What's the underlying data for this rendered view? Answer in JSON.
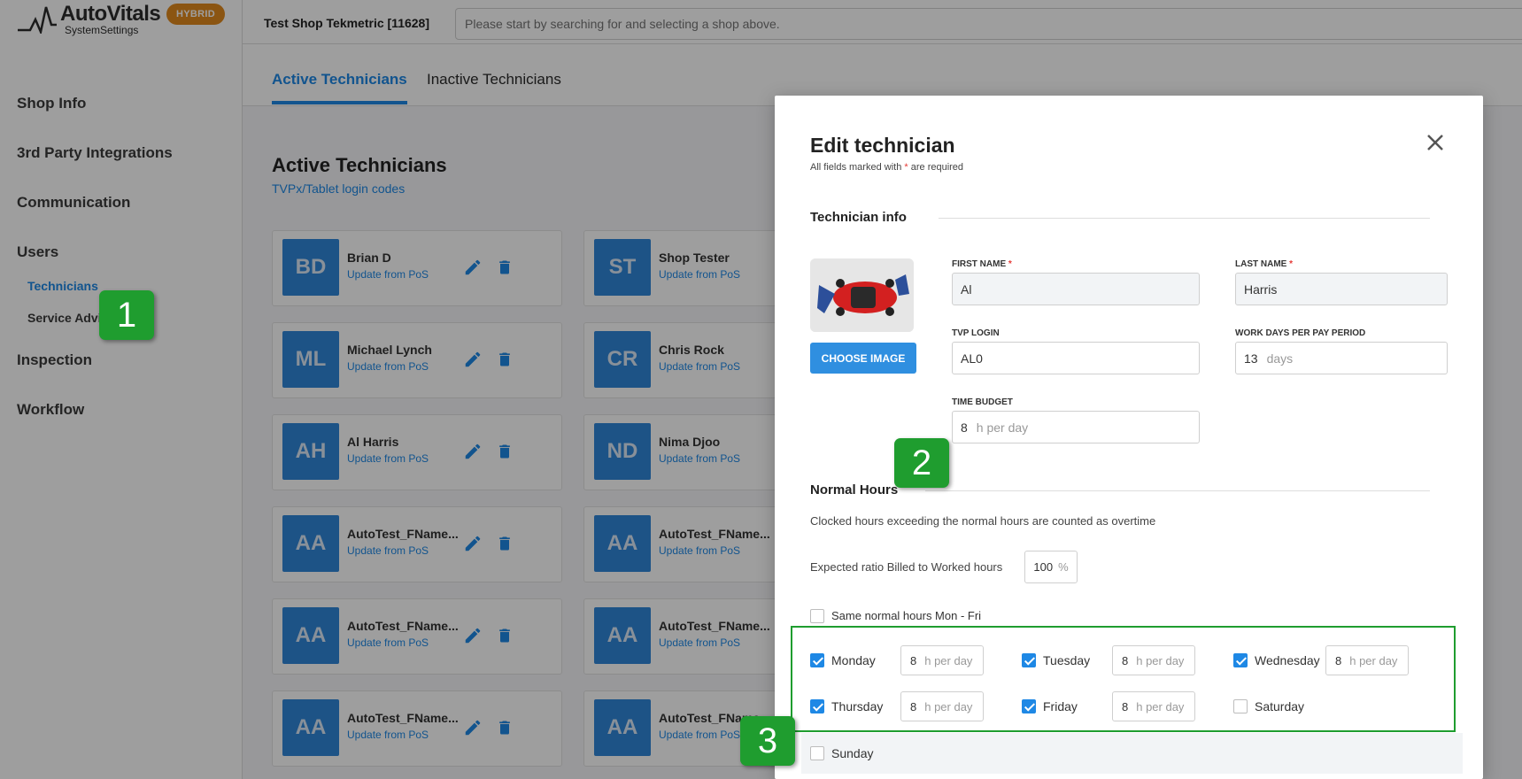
{
  "app": {
    "name": "AutoVitals",
    "subtitle": "SystemSettings",
    "badge": "HYBRID"
  },
  "sidebar": {
    "items": [
      {
        "label": "Shop Info"
      },
      {
        "label": "3rd Party Integrations"
      },
      {
        "label": "Communication"
      },
      {
        "label": "Users"
      },
      {
        "label": "Inspection"
      },
      {
        "label": "Workflow"
      }
    ],
    "subitems": [
      {
        "label": "Technicians"
      },
      {
        "label": "Service Advisors"
      }
    ]
  },
  "topbar": {
    "shop_name": "Test Shop Tekmetric [11628]",
    "search_placeholder": "Please start by searching for and selecting a shop above."
  },
  "tabs": [
    {
      "label": "Active Technicians"
    },
    {
      "label": "Inactive Technicians"
    }
  ],
  "main": {
    "title": "Active Technicians",
    "link": "TVPx/Tablet login codes"
  },
  "technicians": [
    {
      "initials": "BD",
      "name": "Brian D",
      "update": "Update from PoS"
    },
    {
      "initials": "ST",
      "name": "Shop Tester",
      "update": "Update from PoS"
    },
    {
      "initials": "ML",
      "name": "Michael Lynch",
      "update": "Update from PoS"
    },
    {
      "initials": "CR",
      "name": "Chris Rock",
      "update": "Update from PoS"
    },
    {
      "initials": "AH",
      "name": "Al Harris",
      "update": "Update from PoS"
    },
    {
      "initials": "ND",
      "name": "Nima Djoo",
      "update": "Update from PoS"
    },
    {
      "initials": "AA",
      "name": "AutoTest_FName...",
      "update": "Update from PoS"
    },
    {
      "initials": "AA",
      "name": "AutoTest_FName...",
      "update": "Update from PoS"
    },
    {
      "initials": "AA",
      "name": "AutoTest_FName...",
      "update": "Update from PoS"
    },
    {
      "initials": "AA",
      "name": "AutoTest_FName...",
      "update": "Update from PoS"
    },
    {
      "initials": "AA",
      "name": "AutoTest_FName...",
      "update": "Update from PoS"
    },
    {
      "initials": "AA",
      "name": "AutoTest_FName...",
      "update": "Update from PoS"
    }
  ],
  "modal": {
    "title": "Edit technician",
    "required_prefix": "All fields marked with",
    "required_star": "*",
    "required_suffix": "are required",
    "section_info": "Technician info",
    "choose_image": "CHOOSE IMAGE",
    "first_name_label": "FIRST NAME",
    "first_name": "Al",
    "last_name_label": "LAST NAME",
    "last_name": "Harris",
    "tvp_login_label": "TVP LOGIN",
    "tvp_login": "AL0",
    "work_days_label": "WORK DAYS PER PAY PERIOD",
    "work_days": "13",
    "work_days_unit": "days",
    "time_budget_label": "TIME BUDGET",
    "time_budget": "8",
    "time_budget_unit": "h per day",
    "section_hours": "Normal Hours",
    "overtime_note": "Clocked hours exceeding the normal hours are counted as overtime",
    "ratio_label": "Expected ratio Billed to Worked hours",
    "ratio_value": "100",
    "ratio_unit": "%",
    "same_hours_label": "Same normal hours Mon - Fri",
    "days": [
      {
        "label": "Monday",
        "checked": true,
        "hours": "8",
        "unit": "h per day"
      },
      {
        "label": "Tuesday",
        "checked": true,
        "hours": "8",
        "unit": "h per day"
      },
      {
        "label": "Wednesday",
        "checked": true,
        "hours": "8",
        "unit": "h per day"
      },
      {
        "label": "Thursday",
        "checked": true,
        "hours": "8",
        "unit": "h per day"
      },
      {
        "label": "Friday",
        "checked": true,
        "hours": "8",
        "unit": "h per day"
      },
      {
        "label": "Saturday",
        "checked": false
      },
      {
        "label": "Sunday",
        "checked": false
      }
    ]
  },
  "callouts": [
    {
      "label": "1"
    },
    {
      "label": "2"
    },
    {
      "label": "3"
    }
  ]
}
